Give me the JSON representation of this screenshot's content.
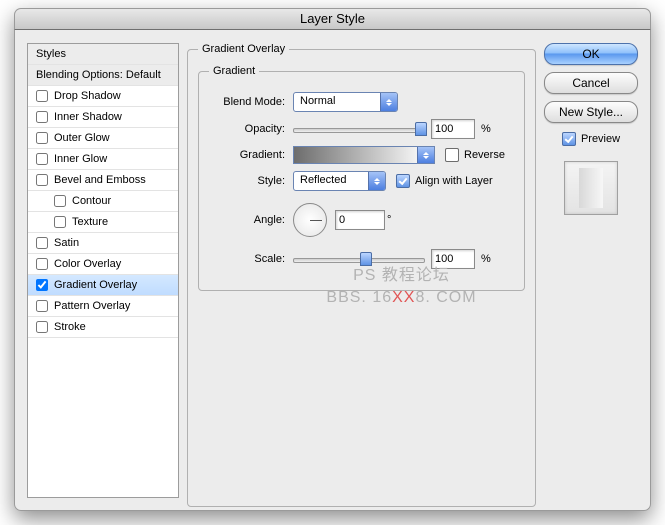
{
  "window": {
    "title": "Layer Style"
  },
  "sidebar": {
    "header_styles": "Styles",
    "header_blend": "Blending Options: Default",
    "items": [
      {
        "label": "Drop Shadow",
        "checked": false,
        "active": false
      },
      {
        "label": "Inner Shadow",
        "checked": false,
        "active": false
      },
      {
        "label": "Outer Glow",
        "checked": false,
        "active": false
      },
      {
        "label": "Inner Glow",
        "checked": false,
        "active": false
      },
      {
        "label": "Bevel and Emboss",
        "checked": false,
        "active": false
      },
      {
        "label": "Contour",
        "checked": false,
        "active": false,
        "sub": true
      },
      {
        "label": "Texture",
        "checked": false,
        "active": false,
        "sub": true
      },
      {
        "label": "Satin",
        "checked": false,
        "active": false
      },
      {
        "label": "Color Overlay",
        "checked": false,
        "active": false
      },
      {
        "label": "Gradient Overlay",
        "checked": true,
        "active": true
      },
      {
        "label": "Pattern Overlay",
        "checked": false,
        "active": false
      },
      {
        "label": "Stroke",
        "checked": false,
        "active": false
      }
    ]
  },
  "panel": {
    "outer_title": "Gradient Overlay",
    "inner_title": "Gradient",
    "blend_mode": {
      "label": "Blend Mode:",
      "value": "Normal"
    },
    "opacity": {
      "label": "Opacity:",
      "value": "100",
      "unit": "%",
      "percent": 100
    },
    "gradient": {
      "label": "Gradient:",
      "reverse_label": "Reverse",
      "reverse": false
    },
    "style": {
      "label": "Style:",
      "value": "Reflected",
      "align_label": "Align with Layer",
      "align": true
    },
    "angle": {
      "label": "Angle:",
      "value": "0",
      "unit": "°"
    },
    "scale": {
      "label": "Scale:",
      "value": "100",
      "unit": "%",
      "percent": 55
    }
  },
  "buttons": {
    "ok": "OK",
    "cancel": "Cancel",
    "new_style": "New Style...",
    "preview_label": "Preview",
    "preview_checked": true
  },
  "watermark": {
    "line1": "PS 教程论坛",
    "line2_a": "BBS. 16",
    "line2_b": "XX",
    "line2_c": "8. COM"
  }
}
